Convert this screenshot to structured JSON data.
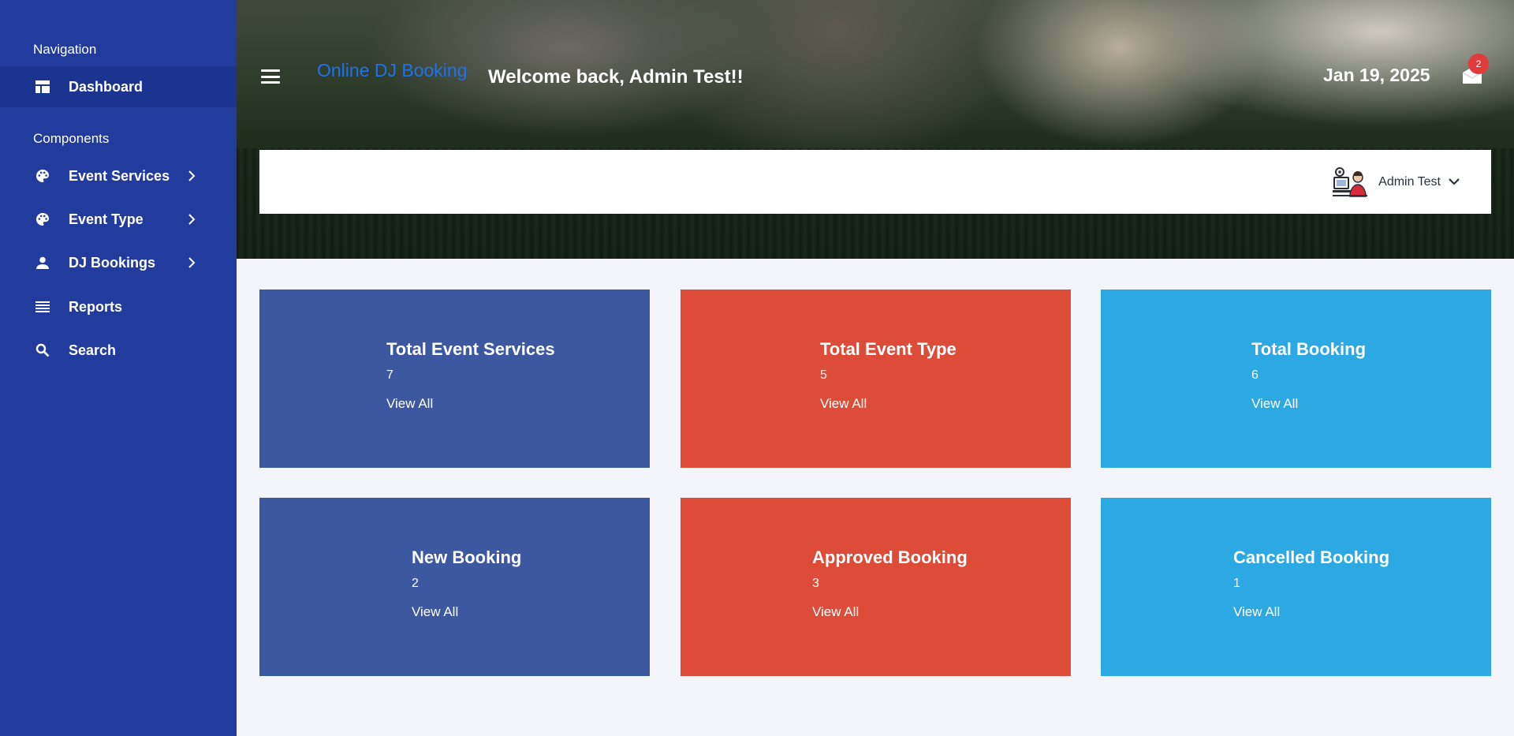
{
  "sidebar": {
    "sections": [
      {
        "heading": "Navigation"
      },
      {
        "heading": "Components"
      }
    ],
    "items": [
      {
        "label": "Dashboard",
        "icon": "dashboard-icon",
        "active": true
      },
      {
        "label": "Event Services",
        "icon": "palette-icon",
        "has_children": true
      },
      {
        "label": "Event Type",
        "icon": "palette-icon",
        "has_children": true
      },
      {
        "label": "DJ Bookings",
        "icon": "user-icon",
        "has_children": true
      },
      {
        "label": "Reports",
        "icon": "list-icon"
      },
      {
        "label": "Search",
        "icon": "search-icon"
      }
    ]
  },
  "header": {
    "brand": "Online DJ Booking",
    "welcome": "Welcome back, Admin Test!!",
    "date": "Jan 19, 2025",
    "mail_badge": "2",
    "user_name": "Admin Test"
  },
  "cards": [
    {
      "title": "Total Event Services",
      "value": "7",
      "link": "View All",
      "color": "#3c58a0"
    },
    {
      "title": "Total Event Type",
      "value": "5",
      "link": "View All",
      "color": "#dd4b39"
    },
    {
      "title": "Total Booking",
      "value": "6",
      "link": "View All",
      "color": "#2ca8e2"
    },
    {
      "title": "New Booking",
      "value": "2",
      "link": "View All",
      "color": "#3c58a0"
    },
    {
      "title": "Approved Booking",
      "value": "3",
      "link": "View All",
      "color": "#dd4b39"
    },
    {
      "title": "Cancelled Booking",
      "value": "1",
      "link": "View All",
      "color": "#2ca8e2"
    }
  ],
  "colors": {
    "sidebar": "#213c9c",
    "sidebar_active": "#1a3490",
    "brand": "#1e73e8",
    "badge": "#e23b3b",
    "content_bg": "#f4f5fa"
  }
}
